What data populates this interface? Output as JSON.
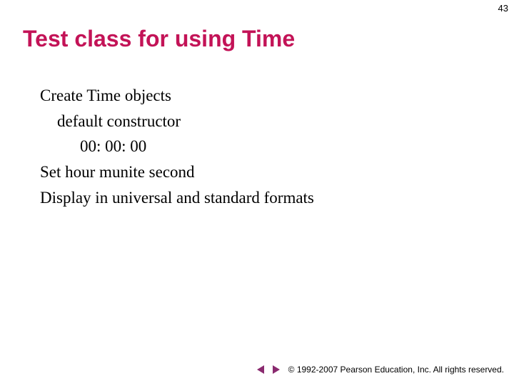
{
  "page_number": "43",
  "title": "Test class for using Time",
  "content": [
    "Create Time objects",
    "default constructor",
    "00: 00: 00",
    "Set hour munite second",
    "Display in universal and standard formats"
  ],
  "copyright": "© 1992-2007 Pearson Education, Inc.  All rights reserved.",
  "accent_color": "#c31357",
  "nav_color": "#8a2a6f"
}
